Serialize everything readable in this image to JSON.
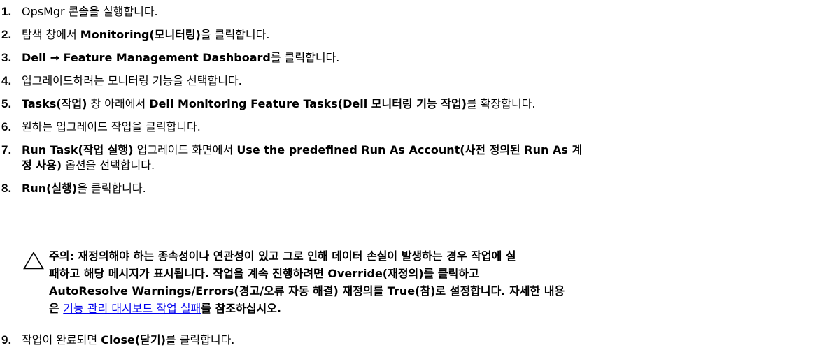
{
  "steps": [
    {
      "num": "1.",
      "a": "OpsMgr 콘솔을 실행합니다."
    },
    {
      "num": "2.",
      "a": "탐색 창에서 ",
      "b": "Monitoring(모니터링)",
      "c": "을 클릭합니다."
    },
    {
      "num": "3.",
      "b": "Dell → Feature Management Dashboard",
      "c": "를 클릭합니다."
    },
    {
      "num": "4.",
      "a": "업그레이드하려는 모니터링 기능을 선택합니다."
    },
    {
      "num": "5.",
      "b": "Tasks(작업)",
      "c": " 창 아래에서 ",
      "d": "Dell Monitoring Feature Tasks(Dell 모니터링 기능 작업)",
      "e": "를 확장합니다."
    },
    {
      "num": "6.",
      "a": "원하는 업그레이드 작업을 클릭합니다."
    },
    {
      "num": "7.",
      "b": "Run Task(작업 실행)",
      "c": " 업그레이드 화면에서 ",
      "d": "Use the predefined Run As Account(사전 정의된 Run As 계",
      "line2_bold": "정 사용)",
      "line2_plain": " 옵션을 선택합니다."
    },
    {
      "num": "8.",
      "b": "Run(실행)",
      "c": "을 클릭합니다."
    },
    {
      "num": "9.",
      "a": "작업이 완료되면 ",
      "b": "Close(닫기)",
      "c": "를 클릭합니다."
    }
  ],
  "caution": {
    "icon": "warning-triangle-icon",
    "line1": "주의: 재정의해야 하는 종속성이나 연관성이 있고 그로 인해 데이터 손실이 발생하는 경우 작업에 실",
    "line2": "패하고 해당 메시지가 표시됩니다. 작업을 계속 진행하려면 Override(재정의)를 클릭하고",
    "line3": "AutoResolve Warnings/Errors(경고/오류 자동 해결) 재정의를 True(참)로 설정합니다. 자세한 내용",
    "line4_prefix": "은 ",
    "link_text": "기능 관리 대시보드 작업 실패",
    "line4_suffix": "를 참조하십시오."
  }
}
